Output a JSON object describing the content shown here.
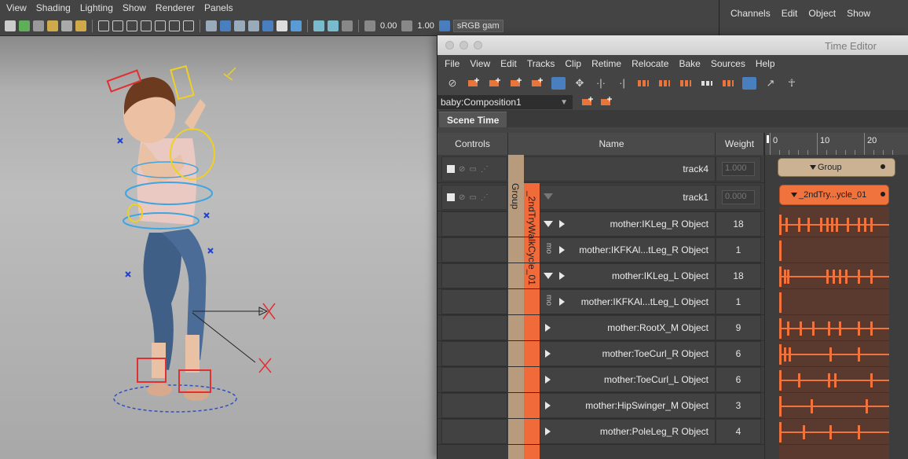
{
  "viewport": {
    "menu": [
      "View",
      "Shading",
      "Lighting",
      "Show",
      "Renderer",
      "Panels"
    ],
    "toolbar": {
      "value_a": "0.00",
      "value_b": "1.00",
      "color_space": "sRGB gam"
    }
  },
  "channels": {
    "menu": [
      "Channels",
      "Edit",
      "Object",
      "Show"
    ]
  },
  "time_editor": {
    "title": "Time Editor",
    "menu": [
      "File",
      "View",
      "Edit",
      "Tracks",
      "Clip",
      "Retime",
      "Relocate",
      "Bake",
      "Sources",
      "Help"
    ],
    "composition": "baby:Composition1",
    "tab": "Scene Time",
    "columns": {
      "controls": "Controls",
      "name": "Name",
      "weight": "Weight"
    },
    "ruler": [
      "0",
      "10",
      "20"
    ],
    "tracks": [
      {
        "name": "track4",
        "weight": "1.000"
      },
      {
        "name": "track1",
        "weight": "0.000"
      }
    ],
    "group_label": "Group",
    "clip_label": "_2ndTryWalkCycle_01",
    "mo_label": "mo",
    "objects": [
      {
        "name": "mother:IKLeg_R Object",
        "value": "18"
      },
      {
        "name": "mother:IKFKAl...tLeg_R Object",
        "value": "1"
      },
      {
        "name": "mother:IKLeg_L Object",
        "value": "18"
      },
      {
        "name": "mother:IKFKAl...tLeg_L Object",
        "value": "1"
      },
      {
        "name": "mother:RootX_M Object",
        "value": "9"
      },
      {
        "name": "mother:ToeCurl_R Object",
        "value": "6"
      },
      {
        "name": "mother:ToeCurl_L Object",
        "value": "6"
      },
      {
        "name": "mother:HipSwinger_M Object",
        "value": "3"
      },
      {
        "name": "mother:PoleLeg_R Object",
        "value": "4"
      }
    ],
    "timeline": {
      "group_clip": "Group",
      "anim_clip": "_2ndTry...ycle_01"
    }
  }
}
